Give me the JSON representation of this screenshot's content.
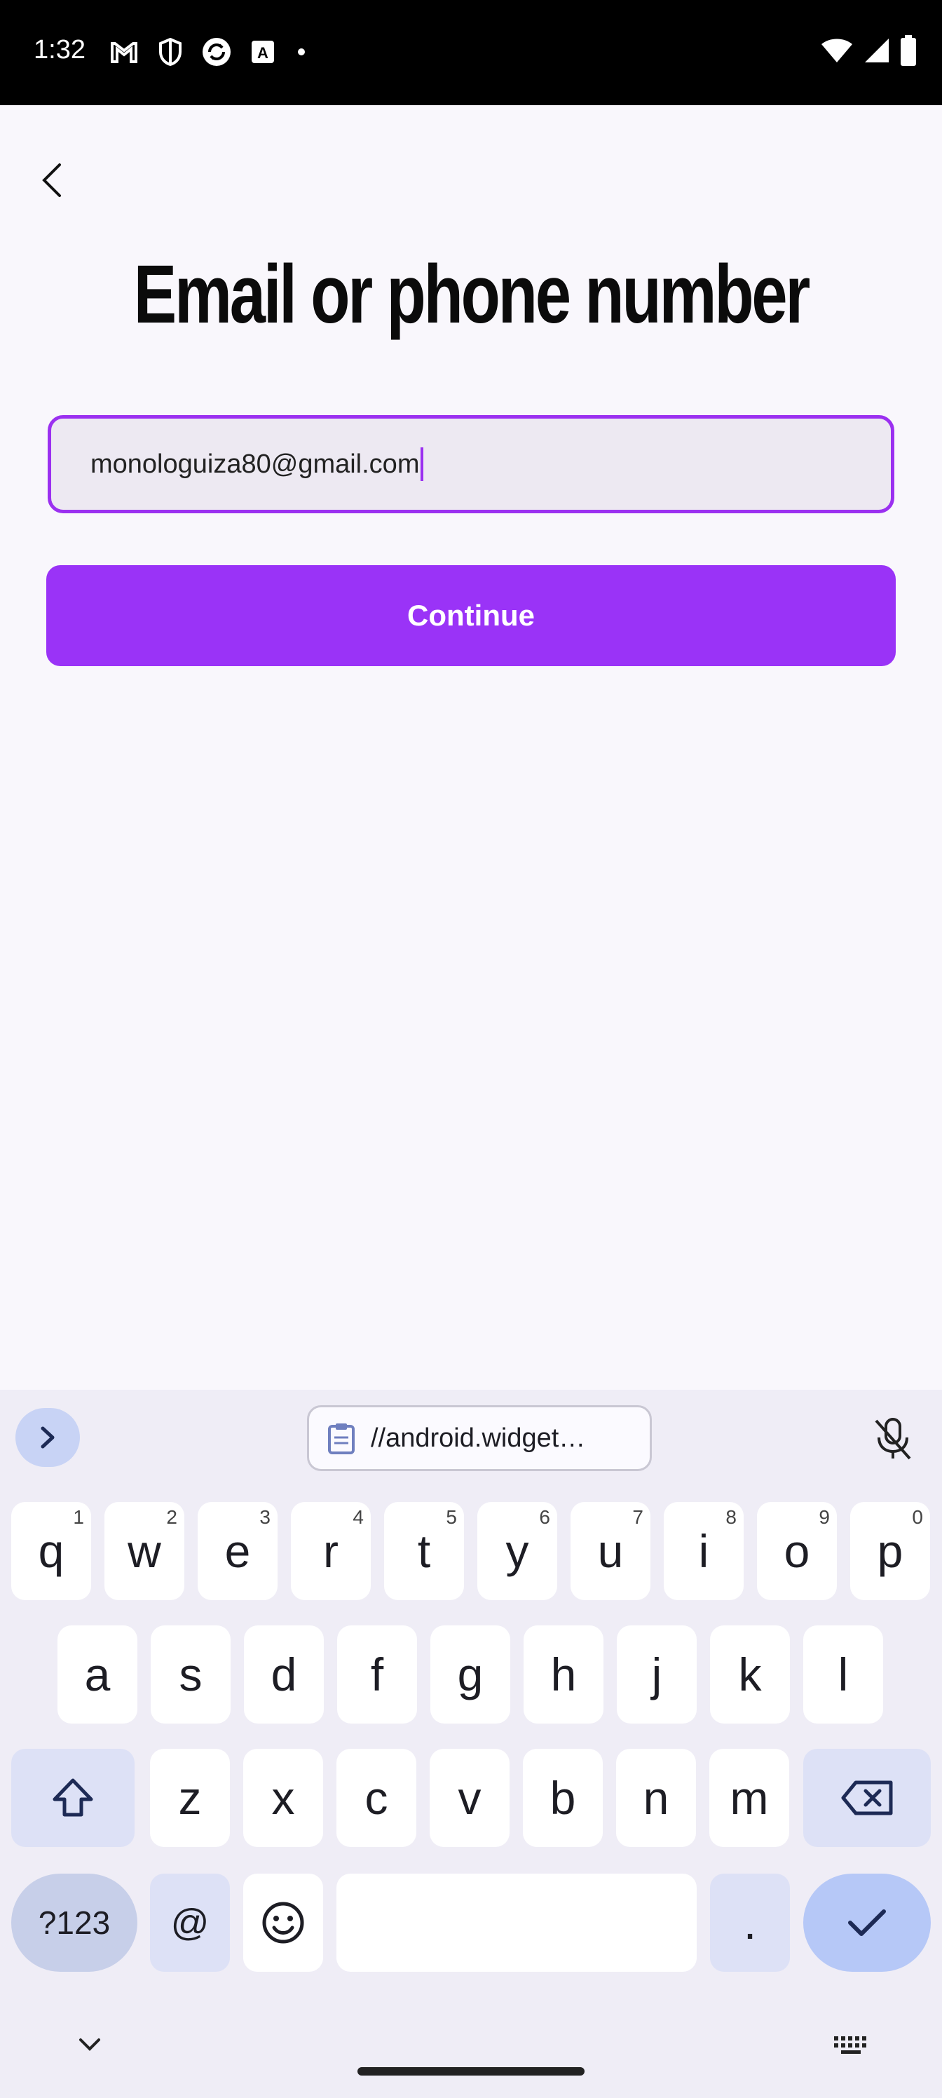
{
  "status_bar": {
    "time": "1:32",
    "icons": [
      "gmail-icon",
      "shield-icon",
      "sync-icon",
      "translate-icon",
      "dot"
    ],
    "right_icons": [
      "wifi-icon",
      "signal-icon",
      "battery-icon"
    ]
  },
  "page": {
    "title": "Email or phone number",
    "email_value": "monologuiza80@gmail.com",
    "continue_label": "Continue"
  },
  "keyboard": {
    "clipboard_text": "//android.widget…",
    "row1": [
      {
        "k": "q",
        "h": "1"
      },
      {
        "k": "w",
        "h": "2"
      },
      {
        "k": "e",
        "h": "3"
      },
      {
        "k": "r",
        "h": "4"
      },
      {
        "k": "t",
        "h": "5"
      },
      {
        "k": "y",
        "h": "6"
      },
      {
        "k": "u",
        "h": "7"
      },
      {
        "k": "i",
        "h": "8"
      },
      {
        "k": "o",
        "h": "9"
      },
      {
        "k": "p",
        "h": "0"
      }
    ],
    "row2": [
      "a",
      "s",
      "d",
      "f",
      "g",
      "h",
      "j",
      "k",
      "l"
    ],
    "row3": [
      "z",
      "x",
      "c",
      "v",
      "b",
      "n",
      "m"
    ],
    "symbols_label": "?123",
    "at_label": "@",
    "period_label": "."
  },
  "colors": {
    "accent": "#9a33f7",
    "background": "#f9f7fc",
    "keyboard_bg": "#efedf6"
  }
}
